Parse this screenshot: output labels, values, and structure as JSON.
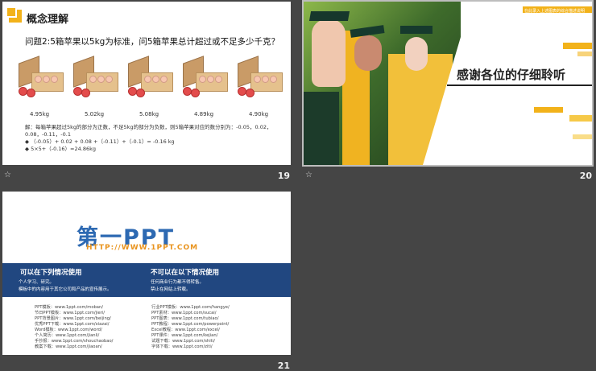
{
  "slides": [
    {
      "id": "19",
      "number_label": "19",
      "title": "概念理解",
      "question": "问题2:5箱苹果以5kg为标准，问5箱苹果总计超过或不足多少千克？",
      "weights": [
        "4.95kg",
        "5.02kg",
        "5.08kg",
        "4.89kg",
        "4.90kg"
      ],
      "notes": [
        "解：每箱苹果超过5kg的部分为正数，不足5kg的部分为负数，则5箱苹果对应的数分别为：-0.05，0.02，0.08，-0.11，-0.1",
        "（-0.05）+ 0.02 + 0.08 +（-0.11）+（-0.1）=  -0.16 kg",
        "5×5+（-0.16）=24.86kg"
      ]
    },
    {
      "id": "20",
      "number_label": "20",
      "thank_you": "感谢各位的仔细聆听",
      "mini_text": "在此录入上述图表的综合描述说明"
    },
    {
      "id": "21",
      "number_label": "21",
      "logo_text": "第一PPT",
      "logo_url": "HTTP://WWW.1PPT.COM",
      "band": {
        "left_title": "可以在下列情况使用",
        "left_items": [
          "个人学习、研究。",
          "模板中的内容用于其它公司和产品的宣传展示。"
        ],
        "right_title": "不可以在以下情况使用",
        "right_items": [
          "任何商业行为都不得转售。",
          "禁止在网站上转载。"
        ]
      },
      "left_links": [
        "PPT模板：www.1ppt.com/moban/",
        "节日PPT模板：www.1ppt.com/jieri/",
        "PPT背景图片：www.1ppt.com/beijing/",
        "优秀PPT下载：www.1ppt.com/xiazai/",
        "Word模板：www.1ppt.com/word/",
        "个人简历：www.1ppt.com/jianli/",
        "手抄报：www.1ppt.com/shouchaobao/",
        "教案下载：www.1ppt.com/jiaoan/"
      ],
      "right_links": [
        "行业PPT模板：www.1ppt.com/hangye/",
        "PPT素材：www.1ppt.com/sucai/",
        "PPT图表：www.1ppt.com/tubiao/",
        "PPT教程：www.1ppt.com/powerpoint/",
        "Excel教程：www.1ppt.com/excel/",
        "PPT课件：www.1ppt.com/kejian/",
        "试题下载：www.1ppt.com/shiti/",
        "字体下载：www.1ppt.com/ziti/"
      ]
    }
  ],
  "star_icon": "☆"
}
